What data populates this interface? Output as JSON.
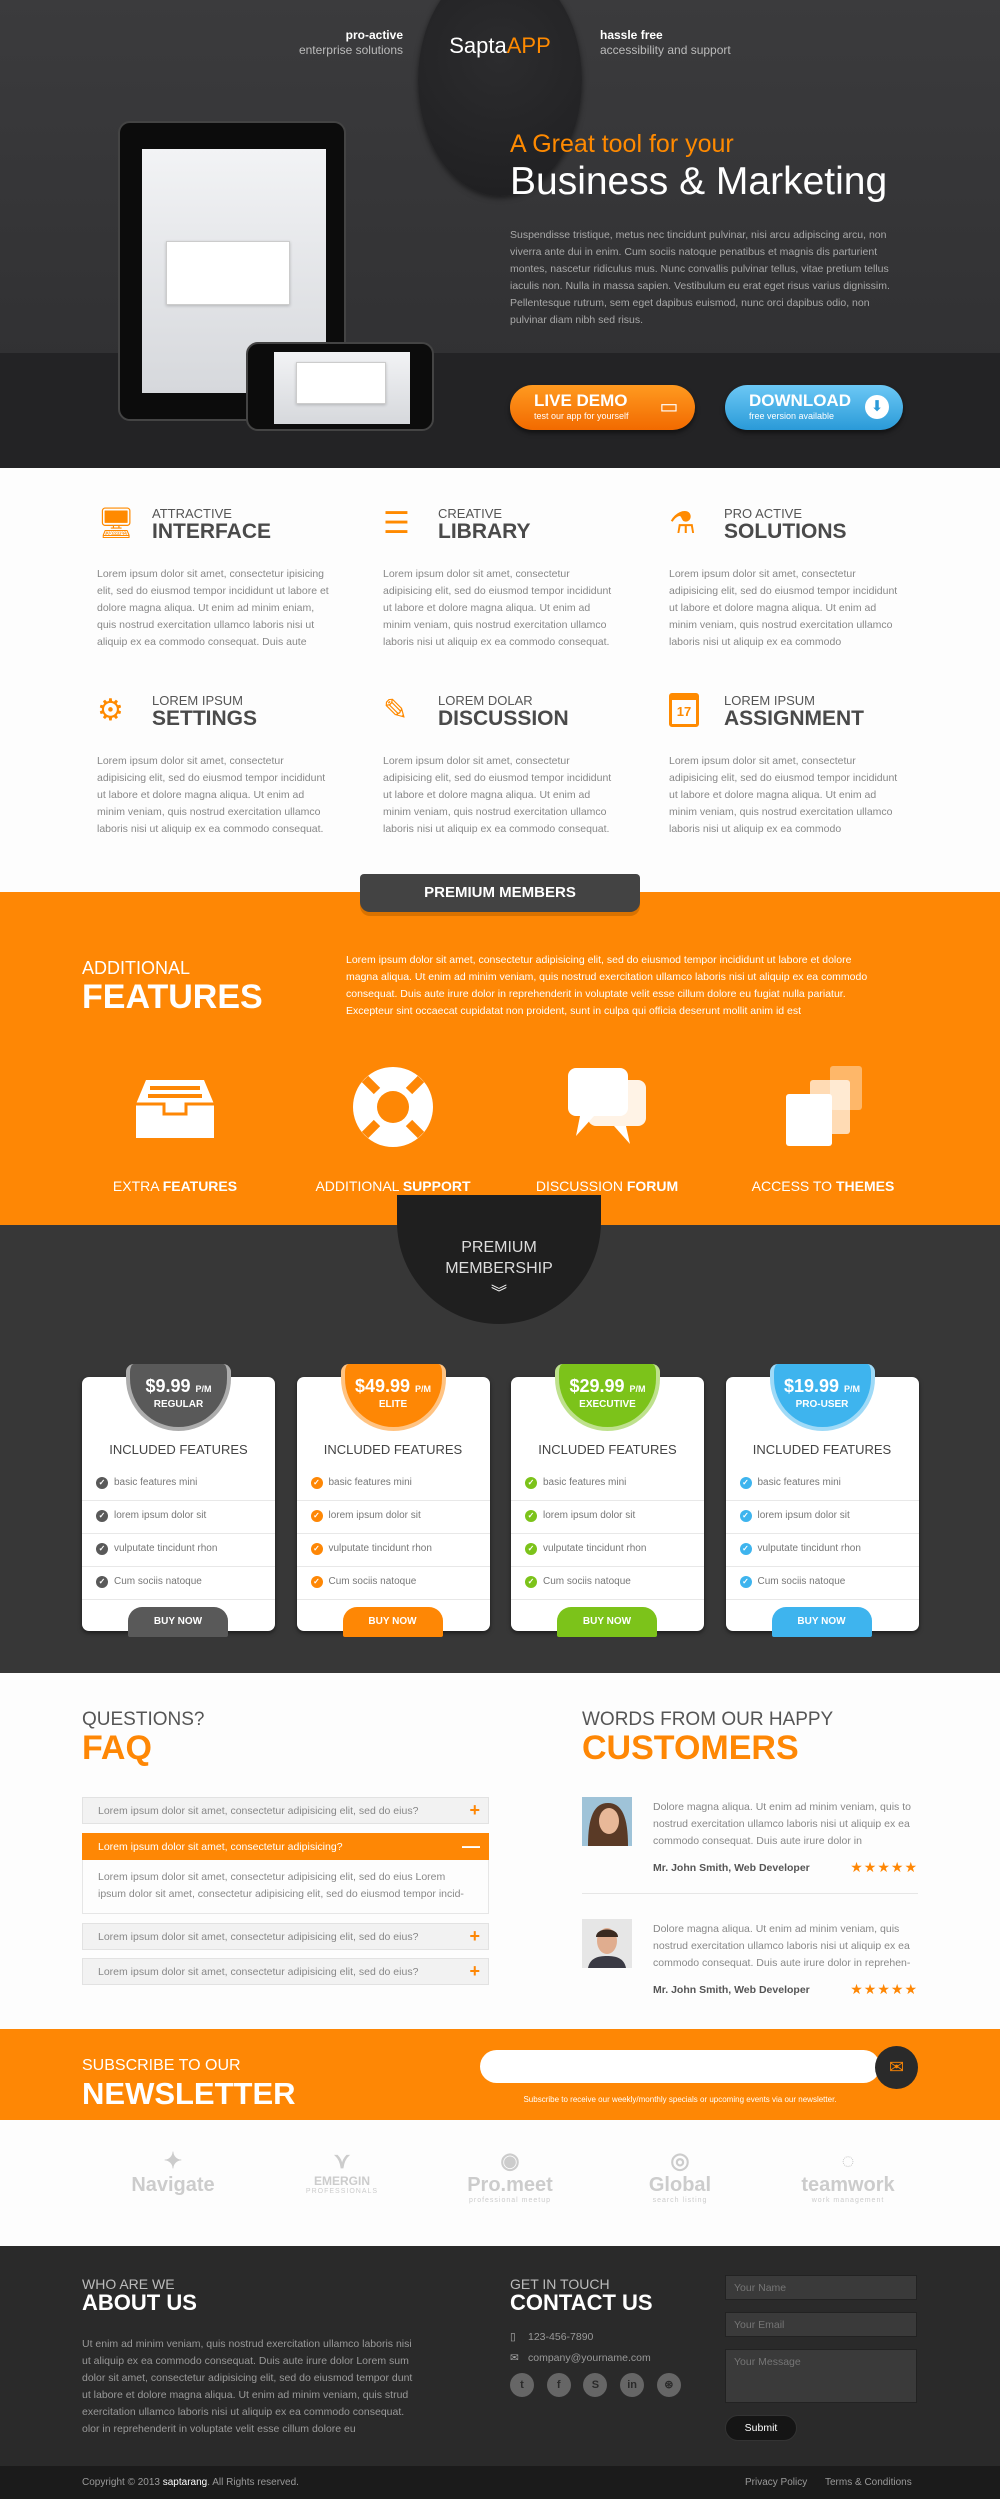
{
  "hero": {
    "left_tag": {
      "bold": "pro-active",
      "text": "enterprise solutions"
    },
    "logo": {
      "part1": "Sapta",
      "part2": "APP"
    },
    "right_tag": {
      "bold": "hassle free",
      "text": "accessibility and support"
    },
    "subtitle": "A Great tool for your",
    "title": "Business & Marketing",
    "paragraph": "Suspendisse tristique, metus nec tincidunt pulvinar, nisi arcu adipiscing arcu, non viverra ante dui in enim. Cum sociis natoque penatibus et magnis dis parturient montes, nascetur ridiculus mus. Nunc convallis pulvinar tellus, vitae pretium tellus iaculis non. Nulla in massa sapien. Vestibulum eu erat eget risus varius dignissim. Pellentesque rutrum, sem eget dapibus euismod, nunc orci dapibus odio, non pulvinar diam nibh sed risus.",
    "live_demo": {
      "title": "LIVE DEMO",
      "sub": "test our app for yourself"
    },
    "download": {
      "title": "DOWNLOAD",
      "sub": "free version available"
    }
  },
  "features": [
    {
      "small": "ATTRACTIVE",
      "big": "INTERFACE",
      "icon": "monitor-icon",
      "glyph": "🖥",
      "text": "Lorem ipsum dolor sit amet, consectetur ipisicing elit, sed do eiusmod tempor incididunt ut labore et dolore magna aliqua. Ut enim ad minim eniam, quis nostrud exercitation ullamco laboris nisi ut aliquip ex ea commodo consequat. Duis aute"
    },
    {
      "small": "CREATIVE",
      "big": "LIBRARY",
      "icon": "books-icon",
      "glyph": "☰",
      "text": "Lorem ipsum dolor sit amet, consectetur adipisicing elit, sed do eiusmod tempor incididunt ut labore et dolore magna aliqua. Ut enim ad minim veniam, quis nostrud exercitation ullamco laboris nisi ut aliquip ex ea commodo consequat."
    },
    {
      "small": "PRO ACTIVE",
      "big": "SOLUTIONS",
      "icon": "flask-icon",
      "glyph": "⚗",
      "text": "Lorem ipsum dolor sit amet, consectetur adipisicing elit, sed do eiusmod tempor incididunt ut labore et dolore magna aliqua. Ut enim ad minim veniam, quis nostrud exercitation ullamco laboris nisi ut aliquip ex ea commodo"
    },
    {
      "small": "LOREM IPSUM",
      "big": "SETTINGS",
      "icon": "gear-icon",
      "glyph": "⚙",
      "text": "Lorem ipsum dolor sit amet, consectetur adipisicing elit, sed do eiusmod tempor incididunt ut labore et dolore magna aliqua. Ut enim ad minim veniam, quis nostrud exercitation ullamco laboris nisi ut aliquip ex ea commodo consequat."
    },
    {
      "small": "LOREM DOLAR",
      "big": "DISCUSSION",
      "icon": "edit-icon",
      "glyph": "✎",
      "text": "Lorem ipsum dolor sit amet, consectetur adipisicing elit, sed do eiusmod tempor incididunt ut labore et dolore magna aliqua. Ut enim ad minim veniam, quis nostrud exercitation ullamco laboris nisi ut aliquip ex ea commodo consequat."
    },
    {
      "small": "LOREM IPSUM",
      "big": "ASSIGNMENT",
      "icon": "calendar-icon",
      "glyph": "17",
      "text": "Lorem ipsum dolor sit amet, consectetur adipisicing elit, sed do eiusmod tempor incididunt ut labore et dolore magna aliqua. Ut enim ad minim veniam, quis nostrud exercitation ullamco laboris nisi ut aliquip ex ea commodo"
    }
  ],
  "premium": {
    "ribbon": "PREMIUM MEMBERS",
    "small": "ADDITIONAL",
    "big": "FEATURES",
    "paragraph": "Lorem ipsum dolor sit amet, consectetur adipisicing elit, sed do eiusmod tempor incididunt ut labore et dolore magna aliqua. Ut enim ad minim veniam, quis nostrud exercitation ullamco laboris nisi ut aliquip ex ea commodo consequat. Duis aute irure dolor in reprehenderit in voluptate velit esse cillum dolore eu fugiat nulla pariatur. Excepteur sint occaecat cupidatat non proident, sunt in culpa qui officia deserunt mollit anim id est",
    "items": [
      {
        "light": "EXTRA",
        "bold": "FEATURES",
        "icon": "inbox-icon"
      },
      {
        "light": "ADDITIONAL",
        "bold": "SUPPORT",
        "icon": "lifebuoy-icon"
      },
      {
        "light": "DISCUSSION",
        "bold": "FORUM",
        "icon": "chat-bubbles-icon"
      },
      {
        "light": "ACCESS TO",
        "bold": "THEMES",
        "icon": "layers-icon"
      }
    ]
  },
  "membership": {
    "line1": "PREMIUM",
    "line2": "MEMBERSHIP",
    "included": "INCLUDED FEATURES",
    "buy": "BUY NOW",
    "per": "P/M",
    "features": [
      "basic features mini",
      "lorem ipsum dolor sit",
      "vulputate tincidunt rhon",
      "Cum sociis natoque"
    ],
    "plans": [
      {
        "price": "$9.99",
        "name": "REGULAR",
        "color": "#595959"
      },
      {
        "price": "$49.99",
        "name": "ELITE",
        "color": "#fe8705"
      },
      {
        "price": "$29.99",
        "name": "EXECUTIVE",
        "color": "#7cc31a"
      },
      {
        "price": "$19.99",
        "name": "PRO-USER",
        "color": "#3eb4ee"
      }
    ]
  },
  "faq": {
    "small": "QUESTIONS?",
    "big": "FAQ",
    "items": [
      {
        "q": "Lorem ipsum dolor sit amet, consectetur adipisicing elit, sed do eius?"
      },
      {
        "q": "Lorem ipsum dolor sit amet, consectetur adipisicing?",
        "a": "Lorem ipsum dolor sit amet, consectetur adipisicing elit, sed do eius Lorem ipsum dolor sit amet, consectetur adipisicing elit, sed do eiusmod tempor incid-"
      },
      {
        "q": "Lorem ipsum dolor sit amet, consectetur adipisicing elit, sed do eius?"
      },
      {
        "q": "Lorem ipsum dolor sit amet, consectetur adipisicing elit, sed do eius?"
      }
    ]
  },
  "customers": {
    "small": "WORDS FROM OUR HAPPY",
    "big": "CUSTOMERS",
    "items": [
      {
        "text": "Dolore magna aliqua. Ut enim ad minim veniam, quis to nostrud exercitation ullamco laboris nisi ut aliquip ex ea commodo consequat. Duis aute irure dolor in",
        "who": "Mr. John Smith, Web Developer",
        "rating": 5
      },
      {
        "text": "Dolore magna aliqua. Ut enim ad minim veniam, quis nostrud exercitation ullamco laboris nisi ut aliquip ex ea commodo consequat. Duis aute irure dolor in reprehen-",
        "who": "Mr. John Smith, Web Developer",
        "rating": 5
      }
    ]
  },
  "newsletter": {
    "small": "SUBSCRIBE TO OUR",
    "big": "NEWSLETTER",
    "note": "Subscribe to receive our weekly/monthly specials or upcoming events via our newsletter."
  },
  "partners": [
    "Navigate",
    "EMERGIN",
    "Pro.meet",
    "Global",
    "teamwork"
  ],
  "partner_subs": [
    "",
    "PROFESSIONALS",
    "professional meetup",
    "search listing",
    "work management"
  ],
  "footer": {
    "about_small": "WHO ARE WE",
    "about_big": "ABOUT US",
    "about_text": "Ut enim ad minim veniam, quis nostrud exercitation ullamco laboris nisi ut aliquip ex ea commodo consequat. Duis aute irure dolor Lorem sum dolor sit amet, consectetur adipisicing elit, sed do eiusmod tempor dunt ut labore et dolore magna aliqua. Ut enim ad minim veniam, quis strud exercitation ullamco laboris nisi ut aliquip ex ea commodo consequat. olor in reprehenderit in voluptate velit esse cillum dolore eu",
    "contact_small": "GET IN TOUCH",
    "contact_big": "CONTACT US",
    "phone": "123-456-7890",
    "email": "company@yourname.com",
    "socials": [
      "twitter",
      "facebook",
      "skype",
      "linkedin",
      "dribbble"
    ],
    "name_ph": "Your Name",
    "email_ph": "Your Email",
    "message_ph": "Your Message",
    "submit": "Submit",
    "copyright_pre": "Copyright © 2013 ",
    "copyright_brand": "saptarang",
    "copyright_post": ". All Rights reserved.",
    "privacy": "Privacy Policy",
    "terms": "Terms & Conditions"
  },
  "colors": {
    "accent": "#fe8705",
    "dark": "#373737",
    "footer": "#2a2a2a"
  }
}
